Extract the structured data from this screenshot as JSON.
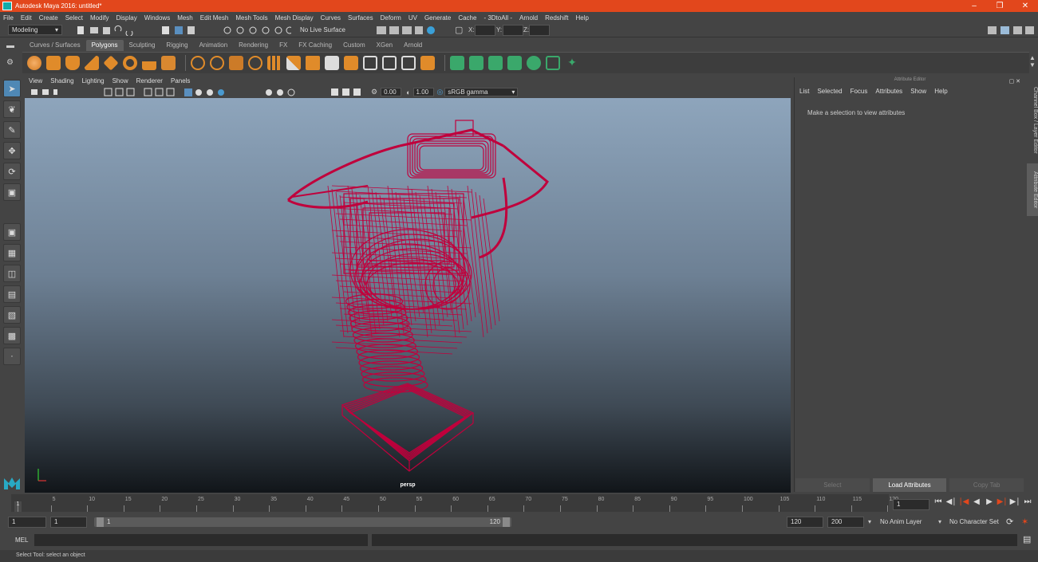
{
  "window": {
    "title": "Autodesk Maya 2016: untitled*"
  },
  "menubar": [
    "File",
    "Edit",
    "Create",
    "Select",
    "Modify",
    "Display",
    "Windows",
    "Mesh",
    "Edit Mesh",
    "Mesh Tools",
    "Mesh Display",
    "Curves",
    "Surfaces",
    "Deform",
    "UV",
    "Generate",
    "Cache",
    "- 3DtoAll -",
    "Arnold",
    "Redshift",
    "Help"
  ],
  "statusline": {
    "mode": "Modeling",
    "live_surface": "No Live Surface",
    "x_label": "X:",
    "y_label": "Y:",
    "z_label": "Z:"
  },
  "shelf_tabs": [
    "Curves / Surfaces",
    "Polygons",
    "Sculpting",
    "Rigging",
    "Animation",
    "Rendering",
    "FX",
    "FX Caching",
    "Custom",
    "XGen",
    "Arnold"
  ],
  "shelf_active": "Polygons",
  "viewport": {
    "menu": [
      "View",
      "Shading",
      "Lighting",
      "Show",
      "Renderer",
      "Panels"
    ],
    "exposure": "0.00",
    "gamma_value": "1.00",
    "color_space": "sRGB gamma",
    "camera_label": "persp",
    "wire_color": "#c0003c"
  },
  "attribute_editor": {
    "header": "Attribute Editor",
    "menu": [
      "List",
      "Selected",
      "Focus",
      "Attributes",
      "Show",
      "Help"
    ],
    "message": "Make a selection to view attributes",
    "buttons": {
      "select": "Select",
      "load": "Load Attributes",
      "copy": "Copy Tab"
    }
  },
  "side_tabs": {
    "channel_box": "Channel Box / Layer Editor",
    "attribute_editor": "Attribute Editor"
  },
  "timeline": {
    "ticks": [
      "5",
      "10",
      "15",
      "20",
      "25",
      "30",
      "35",
      "40",
      "45",
      "50",
      "55",
      "60",
      "65",
      "70",
      "75",
      "80",
      "85",
      "90",
      "95",
      "100",
      "105",
      "110",
      "115",
      "120"
    ],
    "start_tick": "1",
    "current_frame": "1"
  },
  "range": {
    "start": "1",
    "playback_start": "1",
    "slider_start": "1",
    "slider_end": "120",
    "playback_end": "120",
    "end": "200",
    "anim_layer": "No Anim Layer",
    "char_set": "No Character Set"
  },
  "mel": {
    "label": "MEL"
  },
  "help_line": "Select Tool: select an object"
}
